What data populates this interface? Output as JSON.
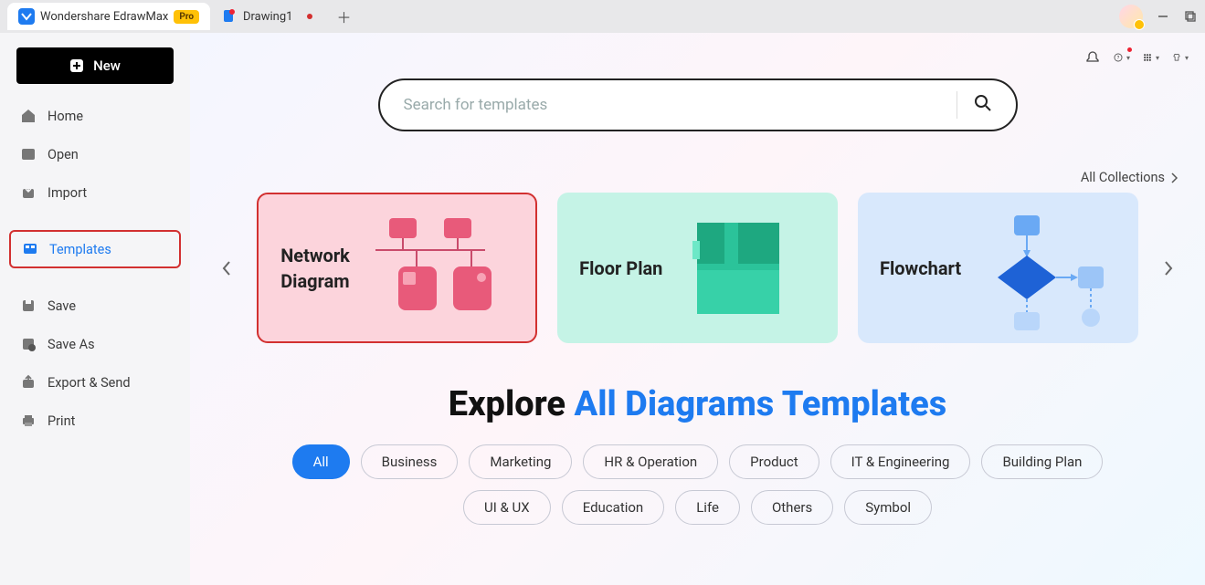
{
  "titlebar": {
    "app_name": "Wondershare EdrawMax",
    "pro_label": "Pro",
    "tab2_label": "Drawing1"
  },
  "sidebar": {
    "new_label": "New",
    "items": [
      {
        "label": "Home"
      },
      {
        "label": "Open"
      },
      {
        "label": "Import"
      },
      {
        "label": "Templates"
      },
      {
        "label": "Save"
      },
      {
        "label": "Save As"
      },
      {
        "label": "Export & Send"
      },
      {
        "label": "Print"
      }
    ]
  },
  "search": {
    "placeholder": "Search for templates"
  },
  "all_collections_label": "All Collections",
  "cards": [
    {
      "title_line1": "Network",
      "title_line2": "Diagram"
    },
    {
      "title": "Floor  Plan"
    },
    {
      "title": "Flowchart"
    }
  ],
  "explore": {
    "prefix": "Explore ",
    "blue": "All Diagrams Templates"
  },
  "chips": [
    "All",
    "Business",
    "Marketing",
    "HR & Operation",
    "Product",
    "IT & Engineering",
    "Building Plan",
    "UI & UX",
    "Education",
    "Life",
    "Others",
    "Symbol"
  ]
}
